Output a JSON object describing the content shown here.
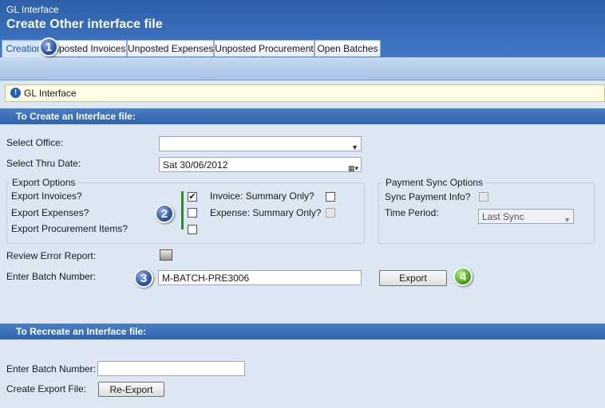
{
  "app": {
    "title": "GL Interface",
    "page_title": "Create Other interface file"
  },
  "tabs": [
    "Creation",
    "Unposted Invoices",
    "Unposted Expenses",
    "Unposted Procurement",
    "Open Batches"
  ],
  "notice": {
    "text": "GL Interface",
    "icon": "info-icon"
  },
  "create_section": {
    "title": "To Create an Interface file:",
    "select_office_label": "Select Office:",
    "select_office_value": "",
    "select_thru_date_label": "Select Thru Date:",
    "thru_date_value": "Sat  30/06/2012",
    "export_options": {
      "title": "Export Options",
      "export_invoices_label": "Export Invoices?",
      "export_expenses_label": "Export Expenses?",
      "export_procurement_label": "Export Procurement Items?",
      "invoices_checked": true,
      "expenses_checked": false,
      "procurement_checked": false,
      "invoice_summary_label": "Invoice: Summary Only?",
      "expense_summary_label": "Expense: Summary Only?",
      "invoice_summary_checked": false,
      "expense_summary_checked": false
    },
    "payment_sync": {
      "title": "Payment Sync Options",
      "sync_label": "Sync Payment Info?",
      "time_period_label": "Time Period:",
      "time_period_value": "Last Sync"
    },
    "review_error_label": "Review Error Report:",
    "batch_number_label": "Enter Batch Number:",
    "batch_number_value": "M-BATCH-PRE3006",
    "export_button": "Export"
  },
  "recreate_section": {
    "title": "To Recreate an Interface file:",
    "batch_number_label": "Enter Batch Number:",
    "batch_number_value": "",
    "create_export_label": "Create Export File:",
    "reexport_button": "Re-Export"
  },
  "callouts": [
    "1",
    "2",
    "3",
    "4"
  ],
  "colors": {
    "header": "#2f5fa8",
    "section_bar": "#3a6db5",
    "background": "#dde7f3",
    "callout_blue": "#2d56a8",
    "callout_green": "#48a821"
  }
}
